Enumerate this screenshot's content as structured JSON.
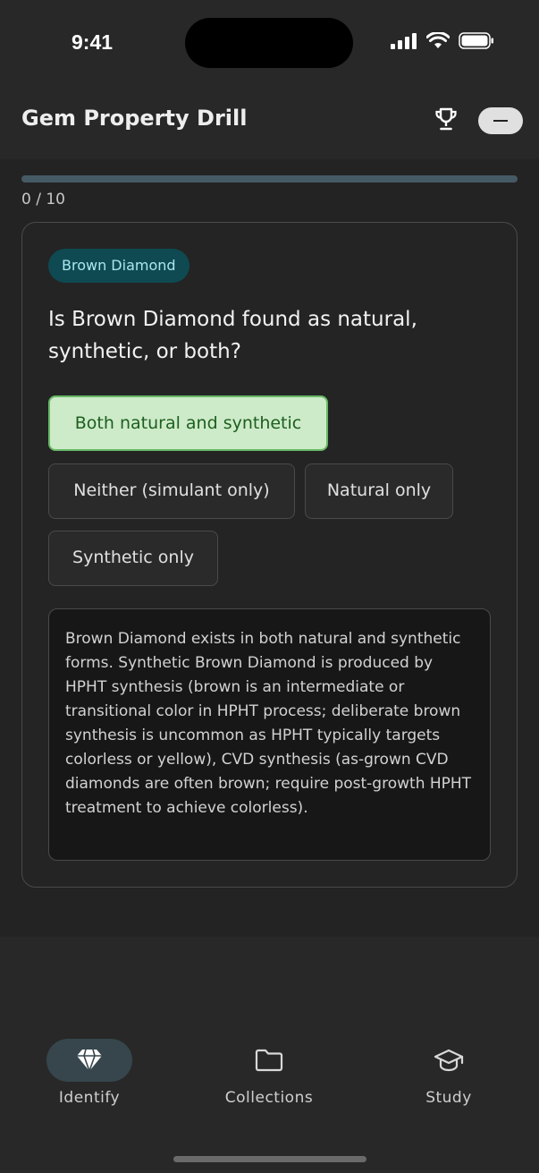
{
  "status": {
    "time": "9:41"
  },
  "header": {
    "title": "Gem Property Drill"
  },
  "progress": {
    "text": "0 / 10",
    "fraction": 0.0
  },
  "card": {
    "chip": "Brown Diamond",
    "question": "Is Brown Diamond found as natural, synthetic, or both?",
    "options": [
      {
        "label": "Both natural and synthetic",
        "state": "correct"
      },
      {
        "label": "Neither (simulant only)",
        "state": "default"
      },
      {
        "label": "Natural only",
        "state": "default"
      },
      {
        "label": "Synthetic only",
        "state": "default"
      }
    ],
    "explanation": "Brown Diamond exists in both natural and synthetic forms. Synthetic Brown Diamond is produced by HPHT synthesis (brown is an intermediate or transitional color in HPHT process; deliberate brown synthesis is uncommon as HPHT typically targets colorless or yellow), CVD synthesis (as-grown CVD diamonds are often brown; require post-growth HPHT treatment to achieve colorless)."
  },
  "nav": {
    "items": [
      {
        "label": "Identify",
        "icon": "diamond-icon",
        "active": true
      },
      {
        "label": "Collections",
        "icon": "folder-icon",
        "active": false
      },
      {
        "label": "Study",
        "icon": "graduation-cap-icon",
        "active": false
      }
    ]
  },
  "colors": {
    "correct_bg": "#cdebc9",
    "correct_border": "#67b866",
    "chip_bg": "#0f4a52",
    "progress_track": "#455a64"
  }
}
